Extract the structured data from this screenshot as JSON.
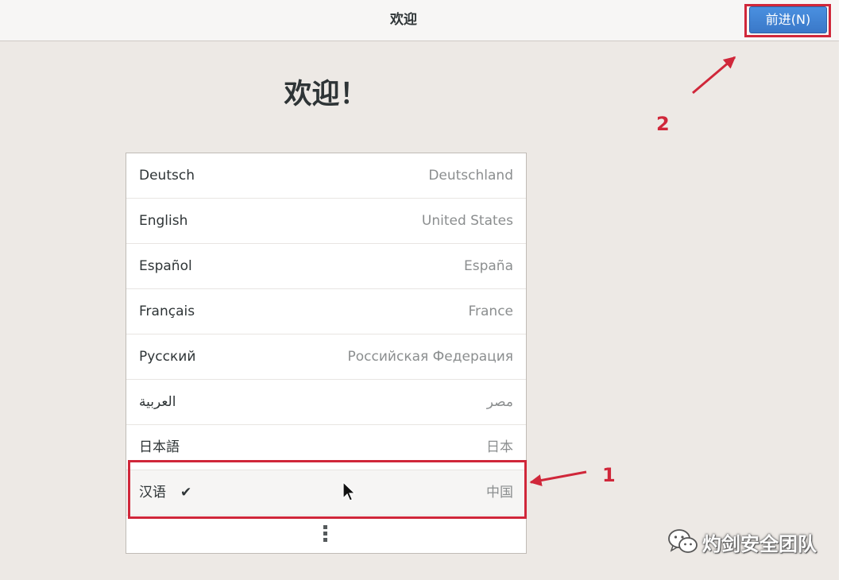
{
  "header": {
    "title": "欢迎",
    "next_label": "前进(N)"
  },
  "page": {
    "title": "欢迎！"
  },
  "languages": [
    {
      "name": "Deutsch",
      "region": "Deutschland"
    },
    {
      "name": "English",
      "region": "United States"
    },
    {
      "name": "Español",
      "region": "España"
    },
    {
      "name": "Français",
      "region": "France"
    },
    {
      "name": "Русский",
      "region": "Российская Федерация"
    },
    {
      "name": "العربية",
      "region": "مصر"
    },
    {
      "name": "日本語",
      "region": "日本"
    },
    {
      "name": "汉语",
      "region": "中国",
      "selected": true
    }
  ],
  "selected_mark": "✔",
  "annotations": {
    "label_1": "1",
    "label_2": "2",
    "color": "#d0273a"
  },
  "watermark": {
    "text": "灼剑安全团队"
  },
  "colors": {
    "accent": "#3a78c8",
    "background": "#ede9e5"
  },
  "icons": {
    "more": "vertical-dots-icon",
    "cursor": "mouse-pointer-icon",
    "watermark": "wechat-icon"
  }
}
